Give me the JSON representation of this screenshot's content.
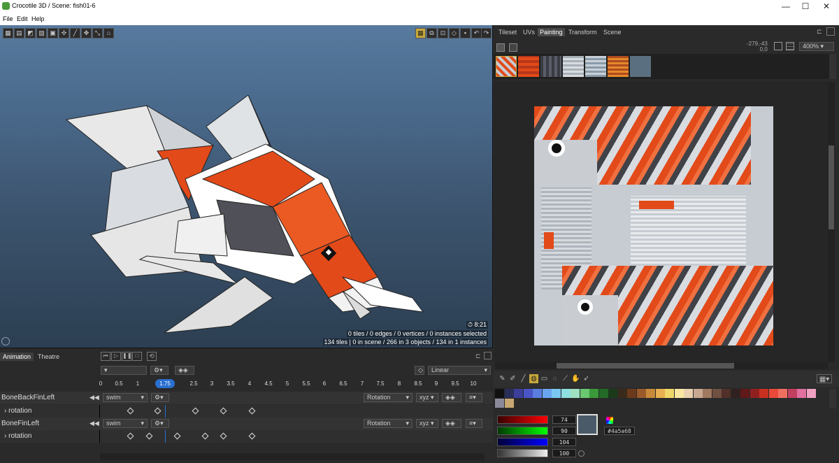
{
  "window": {
    "title": "Crocotile 3D / Scene: fish01-6",
    "minimize": "—",
    "maximize": "☐",
    "close": "✕"
  },
  "menu": [
    "File",
    "Edit",
    "Help"
  ],
  "viewport": {
    "stats_time": "8:21",
    "stats_line1": "0 tiles / 0 edges / 0 vertices / 0 instances selected",
    "stats_line2": "134 tiles | 0 in scene / 266 in 3 objects / 134 in 1 instances"
  },
  "right_tabs": [
    "Tileset",
    "UVs",
    "Painting",
    "Transform",
    "Scene"
  ],
  "active_right_tab": "Painting",
  "painting": {
    "cursor_coords_1": "-279,-43",
    "cursor_coords_2": "0,0",
    "zoom": "400%"
  },
  "color": {
    "r": "74",
    "g": "90",
    "b": "104",
    "a": "100",
    "hex": "#4a5a68"
  },
  "colors": {
    "palette": [
      "#111111",
      "#2a2f5a",
      "#3b3f9a",
      "#4a55c8",
      "#5a7de0",
      "#6aa5f0",
      "#7ac8f0",
      "#8ee0e0",
      "#9ee0c0",
      "#6ac870",
      "#3a9a3a",
      "#236a26",
      "#1a3a1a",
      "#3a2a1a",
      "#6a3a1a",
      "#9a5a2a",
      "#c88a3a",
      "#e8b050",
      "#f0d868",
      "#f8e8a0",
      "#e8d0b0",
      "#c8a890",
      "#a07860",
      "#705040",
      "#503028",
      "#302020",
      "#601818",
      "#902020",
      "#c83020",
      "#e84a3a",
      "#f07060",
      "#c04060",
      "#e070a0",
      "#f0a0c0",
      "#8a8a9a",
      "#c8a870"
    ]
  },
  "animation": {
    "tabs": [
      "Animation",
      "Theatre"
    ],
    "interp": "Linear",
    "timeline_ticks": [
      "0",
      "0.5",
      "1",
      "1.75",
      "2.5",
      "3",
      "3.5",
      "4",
      "4.5",
      "5",
      "5.5",
      "6",
      "6.5",
      "7",
      "7.5",
      "8",
      "8.5",
      "9",
      "9.5",
      "10"
    ],
    "current_time": "1.75",
    "tracks": [
      {
        "name": "BoneBackFinLeft",
        "anim": "swim",
        "mode": "Rotation",
        "axis": "xyz",
        "property": "rotation"
      },
      {
        "name": "BoneFinLeft",
        "anim": "swim",
        "mode": "Rotation",
        "axis": "xyz",
        "property": "rotation"
      }
    ]
  }
}
